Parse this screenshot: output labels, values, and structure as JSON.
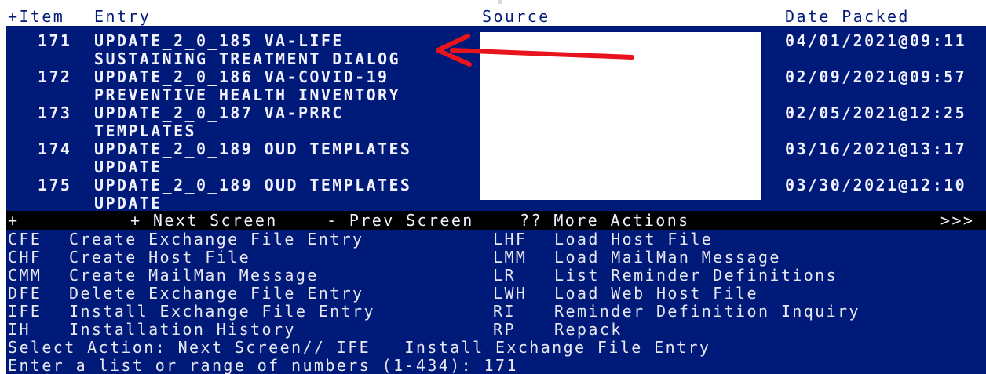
{
  "header": {
    "col_item": "+Item",
    "col_entry": "Entry",
    "col_source": "Source",
    "col_date": "Date Packed"
  },
  "entries": [
    {
      "num": "171",
      "line1": "UPDATE_2_0_185 VA-LIFE",
      "line2": "SUSTAINING TREATMENT DIALOG",
      "date": "04/01/2021@09:11"
    },
    {
      "num": "172",
      "line1": "UPDATE_2_0_186 VA-COVID-19",
      "line2": "PREVENTIVE HEALTH INVENTORY",
      "date": "02/09/2021@09:57"
    },
    {
      "num": "173",
      "line1": "UPDATE_2_0_187 VA-PRRC",
      "line2": "TEMPLATES",
      "date": "02/05/2021@12:25"
    },
    {
      "num": "174",
      "line1": "UPDATE_2_0_189 OUD TEMPLATES",
      "line2": "UPDATE",
      "date": "03/16/2021@13:17"
    },
    {
      "num": "175",
      "line1": "UPDATE_2_0_189 OUD TEMPLATES",
      "line2": "UPDATE",
      "date": "03/30/2021@12:10"
    }
  ],
  "nav": {
    "plus": "+",
    "next": "+ Next Screen",
    "prev": "- Prev Screen",
    "more": "?? More Actions",
    "right": ">>>"
  },
  "actions_left": [
    {
      "code": "CFE",
      "label": "Create Exchange File Entry"
    },
    {
      "code": "CHF",
      "label": "Create Host File"
    },
    {
      "code": "CMM",
      "label": "Create MailMan Message"
    },
    {
      "code": "DFE",
      "label": "Delete Exchange File Entry"
    },
    {
      "code": "IFE",
      "label": "Install Exchange File Entry"
    },
    {
      "code": "IH",
      "label": "Installation History"
    }
  ],
  "actions_right": [
    {
      "code": "LHF",
      "label": "Load Host File"
    },
    {
      "code": "LMM",
      "label": "Load MailMan Message"
    },
    {
      "code": "LR",
      "label": "List Reminder Definitions"
    },
    {
      "code": "LWH",
      "label": "Load Web Host File"
    },
    {
      "code": "RI",
      "label": "Reminder Definition Inquiry"
    },
    {
      "code": "RP",
      "label": "Repack"
    }
  ],
  "prompt": {
    "select_action": "Select Action: Next Screen// IFE   Install Exchange File Entry",
    "enter_list": "Enter a list or range of numbers (1-434): 171"
  },
  "colors": {
    "terminal_bg": "#001a7a",
    "text": "#f2f2ff",
    "nav_bg": "#000000",
    "annotation_arrow": "#e8141c"
  }
}
